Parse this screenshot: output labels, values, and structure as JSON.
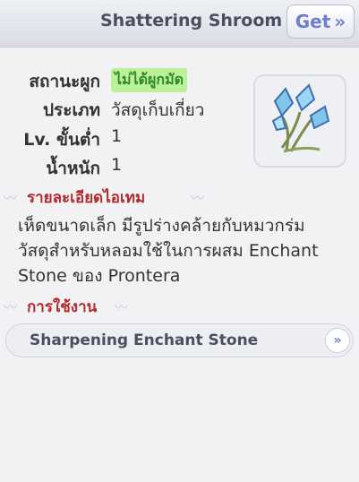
{
  "header": {
    "title": "Shattering Shroom",
    "get_label": "Get",
    "get_chevron": "»"
  },
  "info": [
    {
      "label": "สถานะผูก",
      "value": "ไม่ได้ผูกมัด",
      "badge": true
    },
    {
      "label": "ประเภท",
      "value": "วัสดุเก็บเกี่ยว"
    },
    {
      "label": "Lv. ขั้นต่ำ",
      "value": "1"
    },
    {
      "label": "น้ำหนัก",
      "value": "1"
    }
  ],
  "item_icon": "blue-crystal-mushroom-icon",
  "details": {
    "title": "รายละเอียดไอเทม",
    "line1": "เห็ดขนาดเล็ก มีรูปร่างคล้ายกับหมวกร่ม",
    "line2": "วัสดุสำหรับหลอมใช้ในการผสม Enchant",
    "line3": "Stone ของ Prontera"
  },
  "usage": {
    "title": "การใช้งาน",
    "items": [
      {
        "label": "Sharpening Enchant Stone"
      }
    ]
  },
  "colors": {
    "section_title": "#b22b2b",
    "badge_bg": "#bdf09a",
    "badge_text": "#2e8a28",
    "accent": "#6f7fc8"
  }
}
